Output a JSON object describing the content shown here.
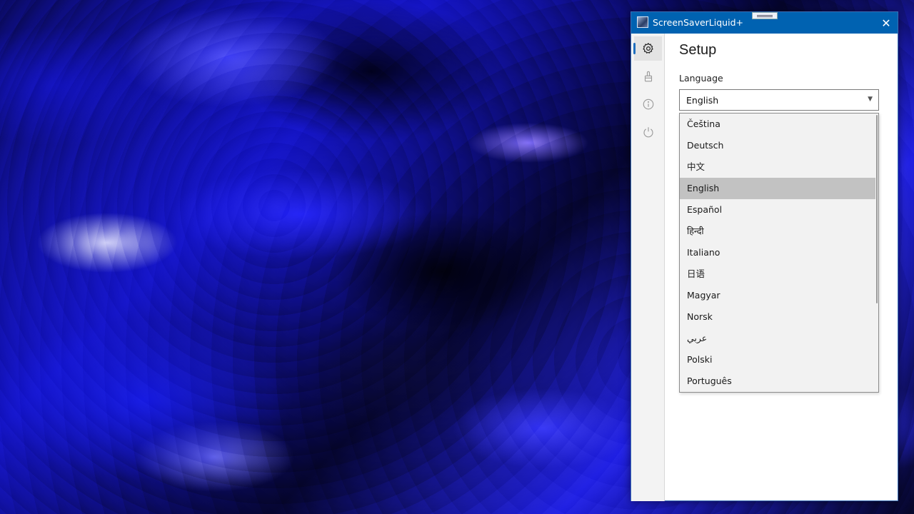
{
  "window": {
    "title": "ScreenSaverLiquid+",
    "close_glyph": "✕"
  },
  "nav": {
    "items": [
      {
        "name": "settings",
        "icon": "gear-icon",
        "active": true
      },
      {
        "name": "brush",
        "icon": "brush-icon",
        "active": false
      },
      {
        "name": "info",
        "icon": "info-icon",
        "active": false
      },
      {
        "name": "power",
        "icon": "power-icon",
        "active": false
      }
    ]
  },
  "setup": {
    "title": "Setup",
    "language_label": "Language",
    "language_value": "English"
  },
  "dropdown": {
    "selected": "English",
    "options": [
      "Čeština",
      "Deutsch",
      "中文",
      "English",
      "Español",
      "हिन्दी",
      "Italiano",
      "日语",
      "Magyar",
      "Norsk",
      "عربي",
      "Polski",
      "Português"
    ]
  },
  "colors": {
    "titlebar": "#0062b1",
    "accent": "#1f6fbf",
    "selected_option": "#c2c2c2"
  }
}
